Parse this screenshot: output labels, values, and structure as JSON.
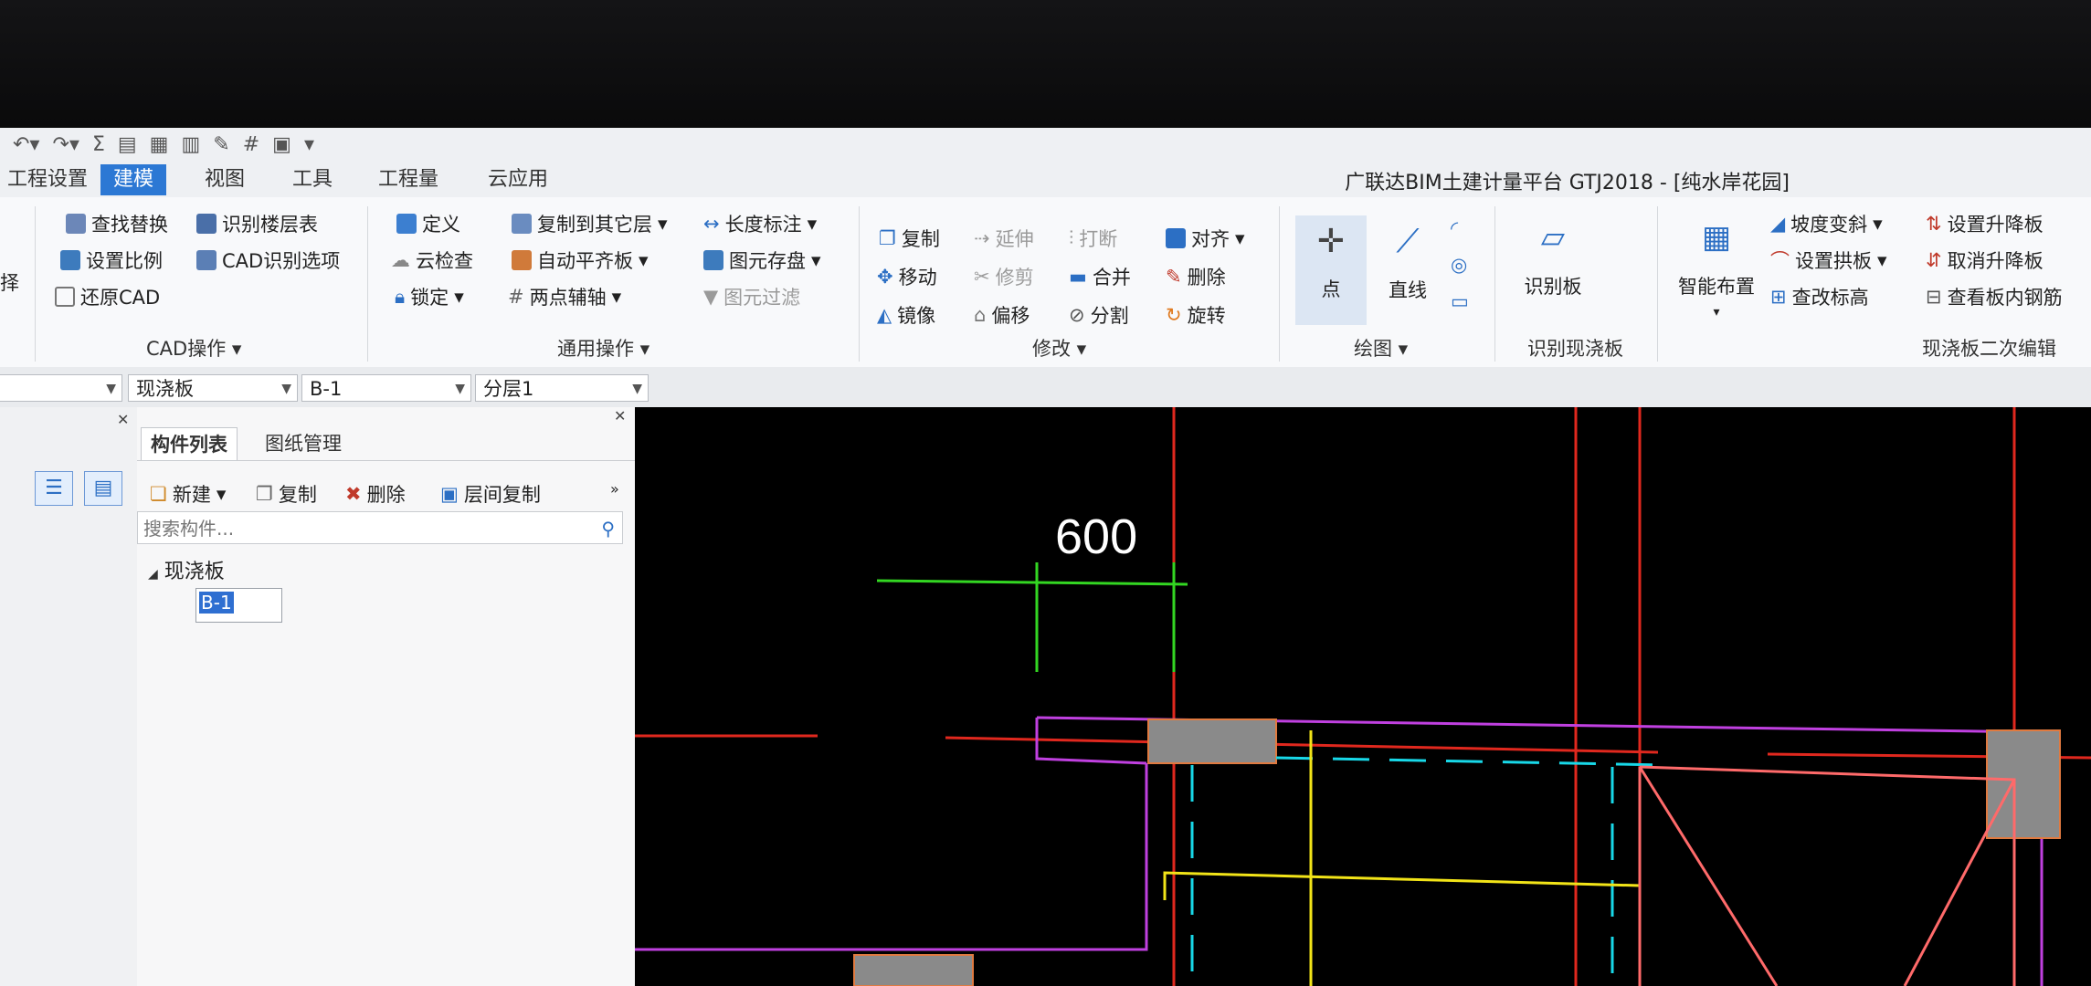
{
  "window": {
    "title": "广联达BIM土建计量平台 GTJ2018 - [纯水岸花园]"
  },
  "tabs": [
    "工程设置",
    "建模",
    "视图",
    "工具",
    "工程量",
    "云应用"
  ],
  "active_tab": "建模",
  "ribbon": {
    "left_cut": "择",
    "cad": {
      "find_replace": "查找替换",
      "identify_floor_table": "识别楼层表",
      "set_scale": "设置比例",
      "cad_options": "CAD识别选项",
      "restore_cad": "还原CAD",
      "group": "CAD操作"
    },
    "general": {
      "define": "定义",
      "cloud_check": "云检查",
      "lock": "锁定",
      "copy_other_floor": "复制到其它层",
      "auto_level_slab": "自动平齐板",
      "two_point_axis": "两点辅轴",
      "length_dim": "长度标注",
      "element_save": "图元存盘",
      "element_filter": "图元过滤",
      "group": "通用操作"
    },
    "modify": {
      "copy": "复制",
      "move": "移动",
      "mirror": "镜像",
      "extend": "延伸",
      "trim": "修剪",
      "offset": "偏移",
      "break": "打断",
      "merge": "合并",
      "split": "分割",
      "align": "对齐",
      "delete": "删除",
      "rotate": "旋转",
      "group": "修改"
    },
    "draw": {
      "point": "点",
      "line": "直线",
      "group": "绘图"
    },
    "recognize": {
      "recognize_slab": "识别板",
      "group": "识别现浇板"
    },
    "secondary": {
      "smart_layout": "智能布置",
      "slope_change": "坡度变斜",
      "set_arch": "设置拱板",
      "check_elevation": "查改标高",
      "set_lift": "设置升降板",
      "cancel_lift": "取消升降板",
      "view_rebar": "查看板内钢筋",
      "group": "现浇板二次编辑"
    }
  },
  "selectors": [
    "",
    "现浇板",
    "B-1",
    "分层1"
  ],
  "panel": {
    "tabs": [
      "构件列表",
      "图纸管理"
    ],
    "toolbar": {
      "new": "新建",
      "copy": "复制",
      "delete": "删除",
      "floor_copy": "层间复制"
    },
    "search_placeholder": "搜索构件...",
    "tree_root": "现浇板",
    "tree_item": "B-1"
  },
  "canvas": {
    "dimension": "600"
  }
}
